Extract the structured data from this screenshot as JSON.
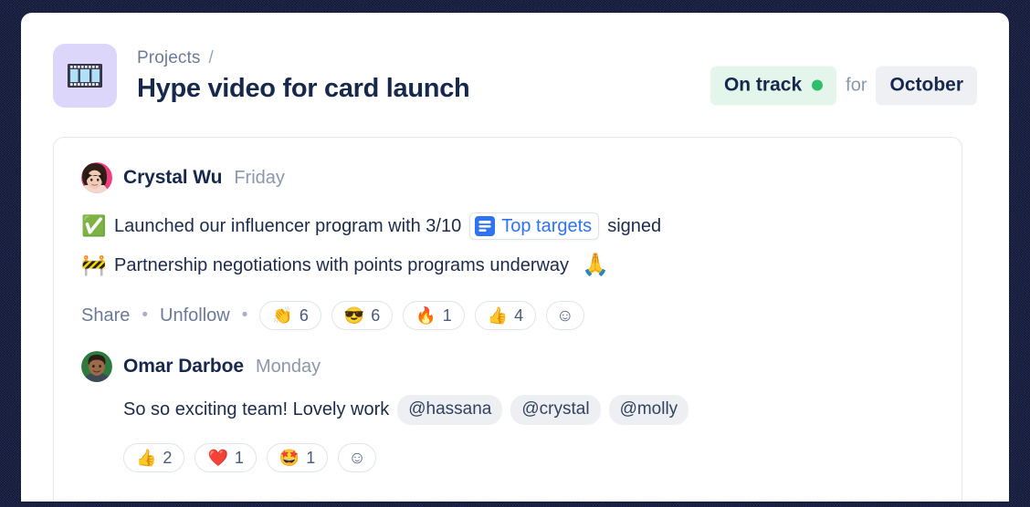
{
  "header": {
    "project_icon": "film-strip-icon",
    "breadcrumb": {
      "parent": "Projects",
      "separator": "/"
    },
    "title": "Hype video for card launch",
    "status": {
      "label": "On track",
      "dot_color": "#2fbf6b",
      "pill_bg": "#e4f6ec",
      "connector": "for",
      "period": "October",
      "period_bg": "#eef0f3"
    }
  },
  "post": {
    "author": {
      "name": "Crystal Wu",
      "timestamp": "Friday",
      "avatar": "crystal-wu-avatar"
    },
    "lines": [
      {
        "emoji": "✅",
        "emoji_name": "check-mark-button-emoji",
        "text_before": "Launched our influencer program with 3/10",
        "link": {
          "icon": "document-list-icon",
          "label": "Top targets",
          "color": "#2f73f2"
        },
        "text_after": "signed",
        "trailing_emoji": ""
      },
      {
        "emoji": "🚧",
        "emoji_name": "construction-barrier-emoji",
        "text_before": "Partnership negotiations with points programs underway",
        "link": null,
        "text_after": "",
        "trailing_emoji": "🙏",
        "trailing_emoji_name": "folded-hands-emoji"
      }
    ],
    "actions": {
      "share": "Share",
      "unfollow": "Unfollow",
      "separator": "•"
    },
    "reactions": [
      {
        "emoji": "👏",
        "name": "clapping-hands-emoji",
        "count": "6"
      },
      {
        "emoji": "😎",
        "name": "smiling-face-with-sunglasses-emoji",
        "count": "6"
      },
      {
        "emoji": "🔥",
        "name": "fire-emoji",
        "count": "1"
      },
      {
        "emoji": "👍",
        "name": "thumbs-up-emoji",
        "count": "4"
      }
    ],
    "add_reaction": {
      "emoji": "☺",
      "name": "add-reaction-icon"
    }
  },
  "comment": {
    "author": {
      "name": "Omar Darboe",
      "timestamp": "Monday",
      "avatar": "omar-darboe-avatar"
    },
    "text": "So so exciting team! Lovely work",
    "mentions": [
      "@hassana",
      "@crystal",
      "@molly"
    ],
    "reactions": [
      {
        "emoji": "👍",
        "name": "thumbs-up-emoji",
        "count": "2"
      },
      {
        "emoji": "❤️",
        "name": "red-heart-emoji",
        "count": "1"
      },
      {
        "emoji": "🤩",
        "name": "star-struck-emoji",
        "count": "1"
      }
    ],
    "add_reaction": {
      "emoji": "☺",
      "name": "add-reaction-icon"
    }
  }
}
